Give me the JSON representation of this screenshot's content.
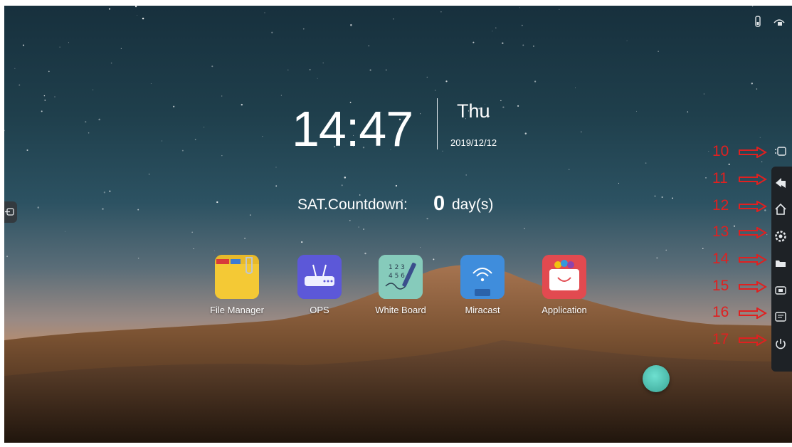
{
  "clock": {
    "time": "14:47",
    "day": "Thu",
    "date": "2019/12/12"
  },
  "countdown": {
    "label": "SAT.Countdown:",
    "value": "0",
    "unit": "day(s)"
  },
  "apps": [
    {
      "label": "File Manager",
      "icon": "folder-icon"
    },
    {
      "label": "OPS",
      "icon": "router-icon"
    },
    {
      "label": "White Board",
      "icon": "pen-board-icon"
    },
    {
      "label": "Miracast",
      "icon": "wifi-display-icon"
    },
    {
      "label": "Application",
      "icon": "app-store-icon"
    }
  ],
  "sidebar": {
    "buttons": [
      {
        "icon": "panel-toggle-icon",
        "marker": "10"
      },
      {
        "icon": "back-icon",
        "marker": "11"
      },
      {
        "icon": "home-icon",
        "marker": "12"
      },
      {
        "icon": "settings-icon",
        "marker": "13"
      },
      {
        "icon": "folder-icon",
        "marker": "14"
      },
      {
        "icon": "source-icon",
        "marker": "15"
      },
      {
        "icon": "whiteboard-icon",
        "marker": "16"
      },
      {
        "icon": "power-icon",
        "marker": "17"
      }
    ]
  },
  "status": [
    "usb-icon",
    "network-icon"
  ],
  "colors": {
    "annotation": "#e02020",
    "sidebar": "#1e2226",
    "fab": "#3aa596"
  }
}
